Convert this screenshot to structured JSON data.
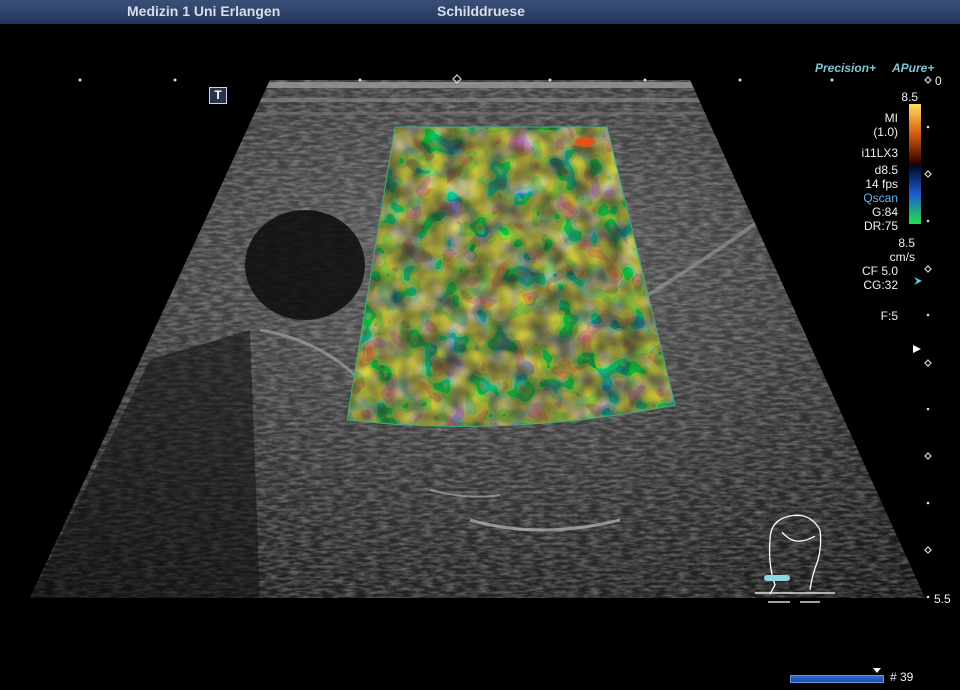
{
  "header": {
    "institution": "Medizin 1 Uni Erlangen",
    "exam": "Schilddruese"
  },
  "modes": {
    "precision": "Precision+",
    "apure": "APure+"
  },
  "t_marker": "T",
  "depth_scale": {
    "top": "0",
    "bottom": "5.5"
  },
  "colorbar_top_value": "8.5",
  "params": {
    "mi_label": "MI",
    "mi_value": "(1.0)",
    "probe": "i11LX3",
    "depth": "d8.5",
    "fps": "14 fps",
    "qscan": "Qscan",
    "gain": "G:84",
    "dynamic_range": "DR:75",
    "velocity": "8.5",
    "velocity_unit": "cm/s",
    "color_frequency": "CF 5.0",
    "color_gain": "CG:32",
    "focus": "F:5"
  },
  "frame_counter": "# 39",
  "colors": {
    "header_bg": "#2c4068",
    "mode_text": "#7ec6d6",
    "roi_outline": "#3fae7e",
    "body_marker_probe": "#8fd6e0",
    "frame_bar": "#2d6ad1"
  },
  "icons": {
    "body_marker": "neck-body-marker-icon",
    "focus_marker": "triangle-focus-icon",
    "velocity_marker": "cyan-arrow-icon"
  }
}
